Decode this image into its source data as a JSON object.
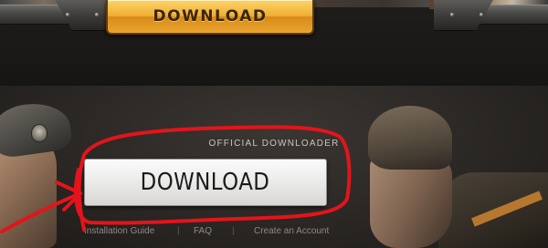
{
  "header": {
    "download_label": "DOWNLOAD"
  },
  "downloader": {
    "heading": "OFFICIAL DOWNLOADER",
    "download_label": "DOWNLOAD"
  },
  "footer": {
    "links": [
      {
        "label": "Installation Guide"
      },
      {
        "label": "FAQ"
      },
      {
        "label": "Create an Account"
      }
    ],
    "separator": "|"
  },
  "colors": {
    "header_button_gold": "#f0ae34",
    "download_button_silver": "#e5e4e2",
    "annotation_red": "#e3141b",
    "background_dark": "#1a1917"
  }
}
